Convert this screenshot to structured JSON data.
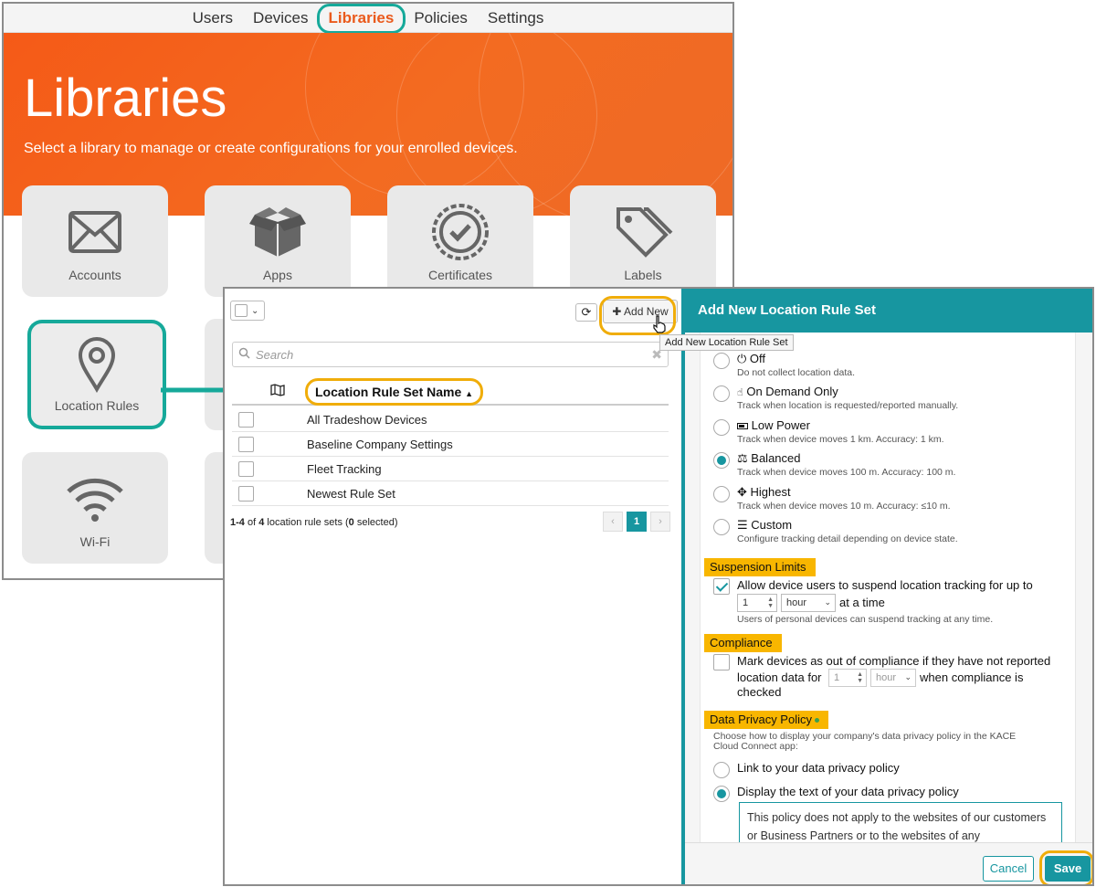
{
  "nav": {
    "items": [
      "Users",
      "Devices",
      "Libraries",
      "Policies",
      "Settings"
    ],
    "active": "Libraries"
  },
  "hero": {
    "title": "Libraries",
    "subtitle": "Select a library to manage or create configurations for your enrolled devices."
  },
  "tiles": [
    {
      "label": "Accounts",
      "icon": "envelope-icon"
    },
    {
      "label": "Apps",
      "icon": "open-box-icon"
    },
    {
      "label": "Certificates",
      "icon": "certificate-seal-icon"
    },
    {
      "label": "Labels",
      "icon": "tags-icon"
    },
    {
      "label": "Location Rules",
      "icon": "map-pin-icon",
      "selected": true
    },
    {
      "label": "Wi-Fi",
      "icon": "wifi-icon"
    }
  ],
  "list": {
    "add_new": "Add New",
    "tooltip": "Add New Location Rule Set",
    "search_placeholder": "Search",
    "column_header": "Location Rule Set Name",
    "rows": [
      "All Tradeshow Devices",
      "Baseline Company Settings",
      "Fleet Tracking",
      "Newest Rule Set"
    ],
    "summary": {
      "range": "1-4",
      "of": "of",
      "total": "4",
      "label": "location rule sets (",
      "selected": "0",
      "selected_label": "selected)"
    },
    "pager": {
      "prev": "‹",
      "current": "1",
      "next": "›"
    }
  },
  "detail": {
    "title": "Add New Location Rule Set",
    "tracking_options": [
      {
        "label": "Off",
        "icon": "power-icon",
        "desc": "Do not collect location data.",
        "selected": false
      },
      {
        "label": "On Demand Only",
        "icon": "hand-icon",
        "desc": "Track when location is requested/reported manually.",
        "selected": false
      },
      {
        "label": "Low Power",
        "icon": "battery-icon",
        "desc": "Track when device moves 1 km. Accuracy: 1 km.",
        "selected": false
      },
      {
        "label": "Balanced",
        "icon": "scale-icon",
        "desc": "Track when device moves 100 m. Accuracy: 100 m.",
        "selected": true
      },
      {
        "label": "Highest",
        "icon": "crosshair-icon",
        "desc": "Track when device moves 10 m. Accuracy: ≤10 m.",
        "selected": false
      },
      {
        "label": "Custom",
        "icon": "sliders-icon",
        "desc": "Configure tracking detail depending on device state.",
        "selected": false
      }
    ],
    "suspension": {
      "heading": "Suspension Limits",
      "label": "Allow device users to suspend location tracking for up to",
      "checked": true,
      "value": "1",
      "unit": "hour",
      "suffix": "at a time",
      "note": "Users of personal devices can suspend tracking at any time."
    },
    "compliance": {
      "heading": "Compliance",
      "label_line1": "Mark devices as out of compliance if they have not reported",
      "label_line2a": "location data for",
      "value": "1",
      "unit": "hour",
      "label_line2b": "when compliance is",
      "label_line3": "checked",
      "checked": false
    },
    "privacy": {
      "heading": "Data Privacy Policy",
      "desc_line1": "Choose how to display your company's data privacy policy in the KACE",
      "desc_line2": "Cloud Connect app:",
      "options": [
        {
          "label": "Link to your data privacy policy",
          "selected": false
        },
        {
          "label": "Display the text of your data privacy policy",
          "selected": true
        }
      ],
      "text": "This policy does not apply to the websites of our customers or Business Partners or to the websites of any"
    },
    "cancel": "Cancel",
    "save": "Save"
  },
  "colors": {
    "accent": "#1796a0",
    "hero_orange": "#f55a17",
    "highlight_yellow": "#f8b600",
    "callout_teal": "#16a99a",
    "callout_gold": "#f0ad0a"
  }
}
